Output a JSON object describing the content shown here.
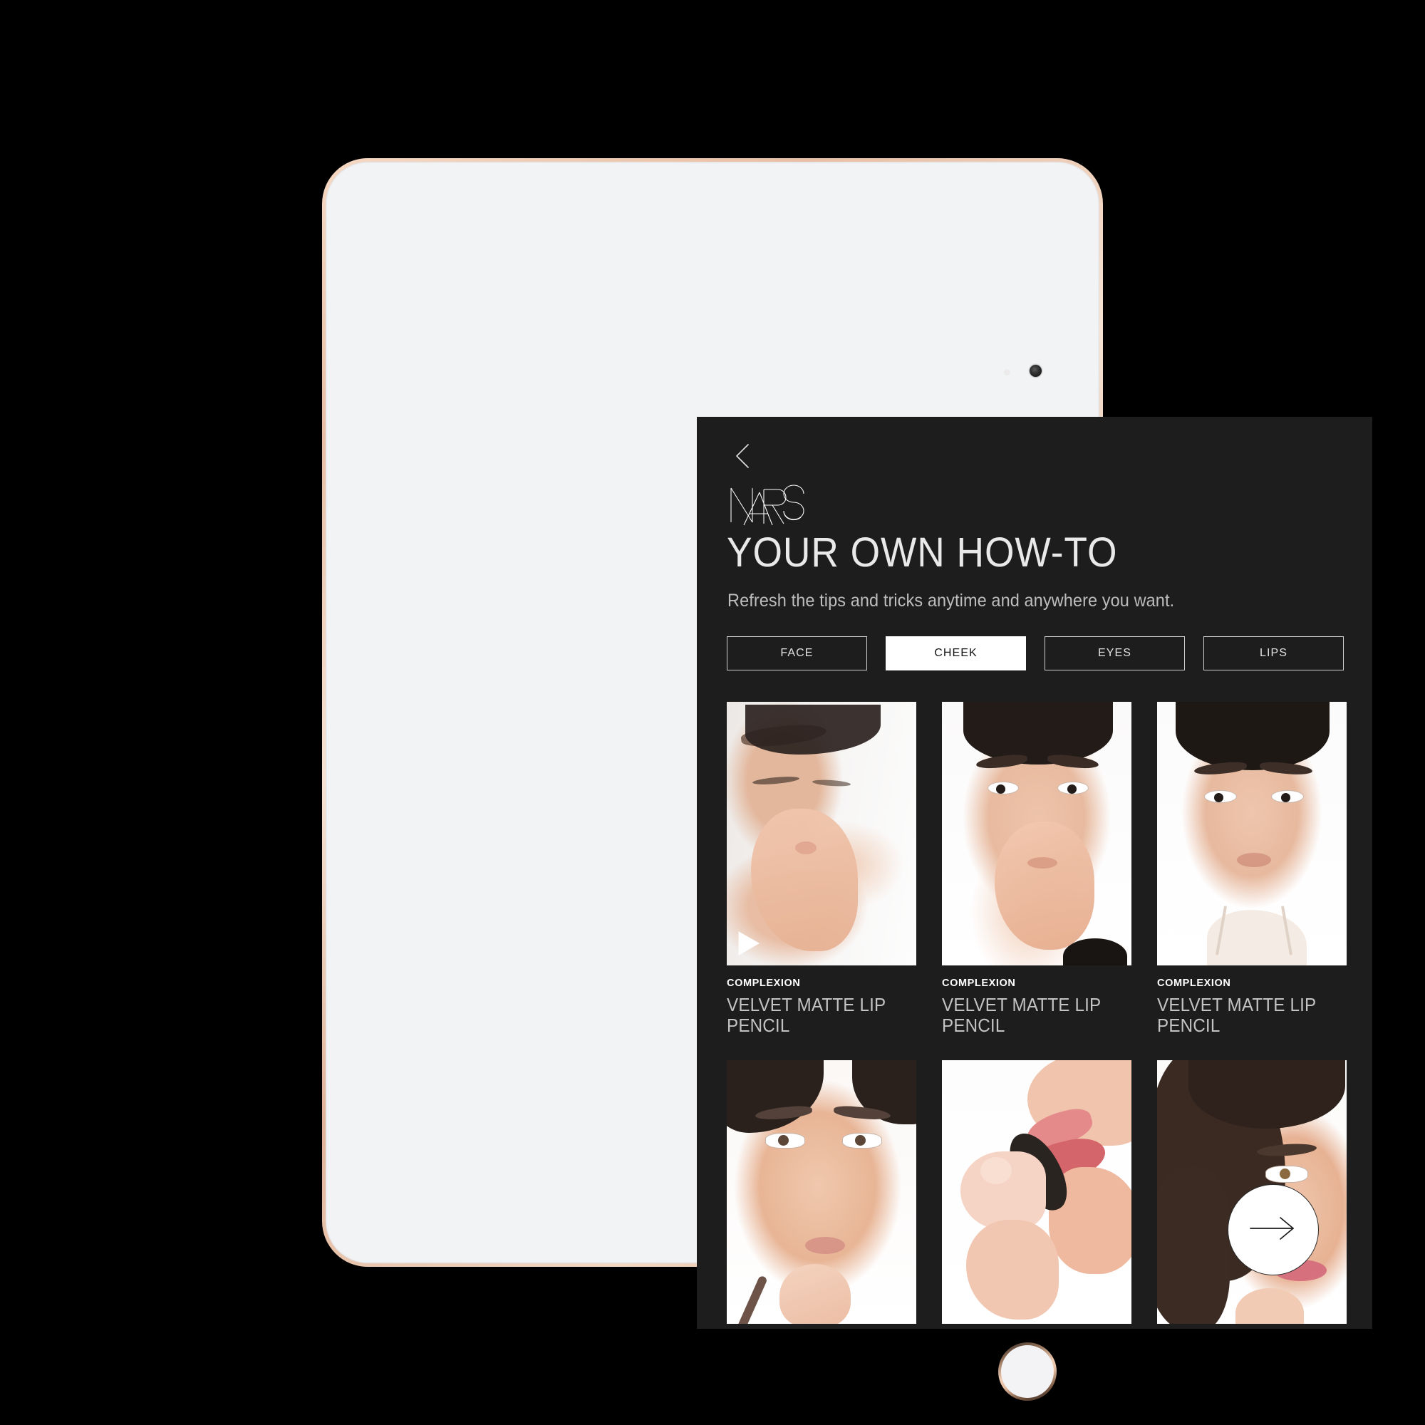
{
  "device": {
    "type": "tablet",
    "finish": "rose-gold",
    "home_button": "home-button",
    "camera": "front-camera"
  },
  "app": {
    "background_color": "#1d1d1d",
    "back_label": "Back",
    "brand": "NARS",
    "title": "YOUR OWN HOW-TO",
    "subtitle": "Refresh the tips and tricks anytime and anywhere you want."
  },
  "tabs": [
    {
      "label": "FACE",
      "active": false
    },
    {
      "label": "CHEEK",
      "active": true
    },
    {
      "label": "EYES",
      "active": false
    },
    {
      "label": "LIPS",
      "active": false
    }
  ],
  "cards": [
    {
      "eyebrow": "COMPLEXION",
      "name": "VELVET MATTE LIP PENCIL",
      "has_play": true,
      "image_alt": "Model with eyes closed blending product onto cheek with fingertips"
    },
    {
      "eyebrow": "COMPLEXION",
      "name": "VELVET MATTE LIP PENCIL",
      "has_play": true,
      "image_alt": "Model facing forward blending product across cheek with hand"
    },
    {
      "eyebrow": "COMPLEXION",
      "name": "VELVET MATTE LIP PENCIL",
      "has_play": true,
      "image_alt": "Model facing camera with finished complexion look"
    },
    {
      "eyebrow": "",
      "name": "",
      "has_play": false,
      "image_alt": "Model applying lip pencil to lower lip"
    },
    {
      "eyebrow": "",
      "name": "",
      "has_play": false,
      "image_alt": "Close-up of lipstick bullet applied to lips"
    },
    {
      "eyebrow": "",
      "name": "",
      "has_play": false,
      "image_alt": "Curly-haired model applying product near lips"
    }
  ],
  "next_button": {
    "label": "Next",
    "icon": "arrow-right-icon"
  },
  "colors": {
    "screen_bg": "#1d1d1d",
    "accent_white": "#ffffff",
    "text_primary": "#e9e9e9",
    "text_secondary": "#bdbdbd",
    "device_metal": "#e8bfa4"
  }
}
